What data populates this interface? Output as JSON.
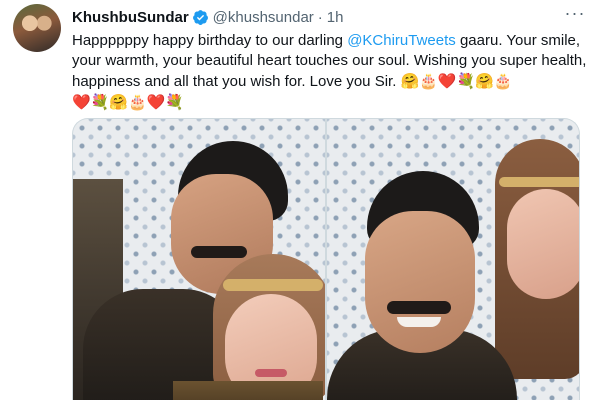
{
  "tweet": {
    "display_name": "KhushbuSundar",
    "handle": "@khushsundar",
    "separator": "·",
    "time": "1h",
    "more_label": "···",
    "text_before_mention": "Happppppy happy birthday to our darling ",
    "mention": "@KChiruTweets",
    "text_after_mention": " gaaru. Your smile, your warmth, your beautiful heart touches our soul. Wishing you super health, happiness and all that you wish for. Love you Sir.",
    "emoji_line_1": "🤗🎂❤️💐🤗🎂",
    "emoji_line_2": "❤️💐🤗🎂❤️💐"
  },
  "media": {
    "photo_count": 2
  },
  "colors": {
    "link": "#1d9bf0",
    "secondary_text": "#536471",
    "primary_text": "#0f1419",
    "verified": "#1d9bf0"
  }
}
